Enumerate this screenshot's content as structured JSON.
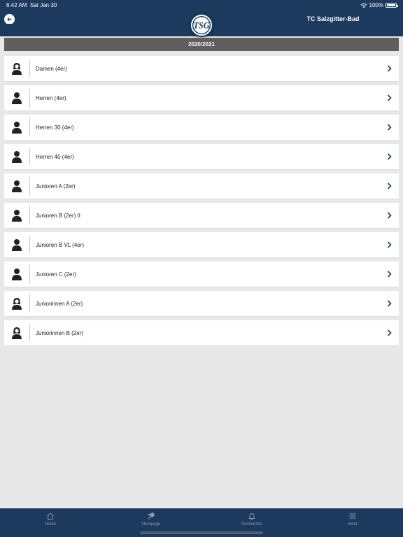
{
  "status_bar": {
    "time": "6:42 AM",
    "date": "Sat Jan 30",
    "battery": "100%"
  },
  "header": {
    "title": "TC Salzgitter-Bad",
    "logo_text": "TSG"
  },
  "season": "2020/2021",
  "teams": [
    {
      "label": "Damen (4er)",
      "icon": "female-person-icon"
    },
    {
      "label": "Herren (4er)",
      "icon": "male-person-icon"
    },
    {
      "label": "Herren 30 (4er)",
      "icon": "male-person-icon"
    },
    {
      "label": "Herren 40 (4er)",
      "icon": "male-person-icon"
    },
    {
      "label": "Junioren A (2er)",
      "icon": "male-person-icon"
    },
    {
      "label": "Junioren B (2er) II",
      "icon": "male-person-icon"
    },
    {
      "label": "Junioren B VL (4er)",
      "icon": "male-person-icon"
    },
    {
      "label": "Junioren C (2er)",
      "icon": "male-person-icon"
    },
    {
      "label": "Juniorinnen A (2er)",
      "icon": "female-person-icon"
    },
    {
      "label": "Juniorinnen B (2er)",
      "icon": "female-person-icon"
    }
  ],
  "tabs": [
    {
      "label": "Home",
      "icon": "home-icon"
    },
    {
      "label": "Hompage",
      "icon": "tennis-racket-icon"
    },
    {
      "label": "Pusharchiv",
      "icon": "bell-icon"
    },
    {
      "label": "mehr",
      "icon": "menu-icon"
    }
  ],
  "colors": {
    "header": "#1b3a5e",
    "season_bar": "#5f5f5f",
    "chevron": "#1b4b7a",
    "background": "#e8e8e8"
  }
}
